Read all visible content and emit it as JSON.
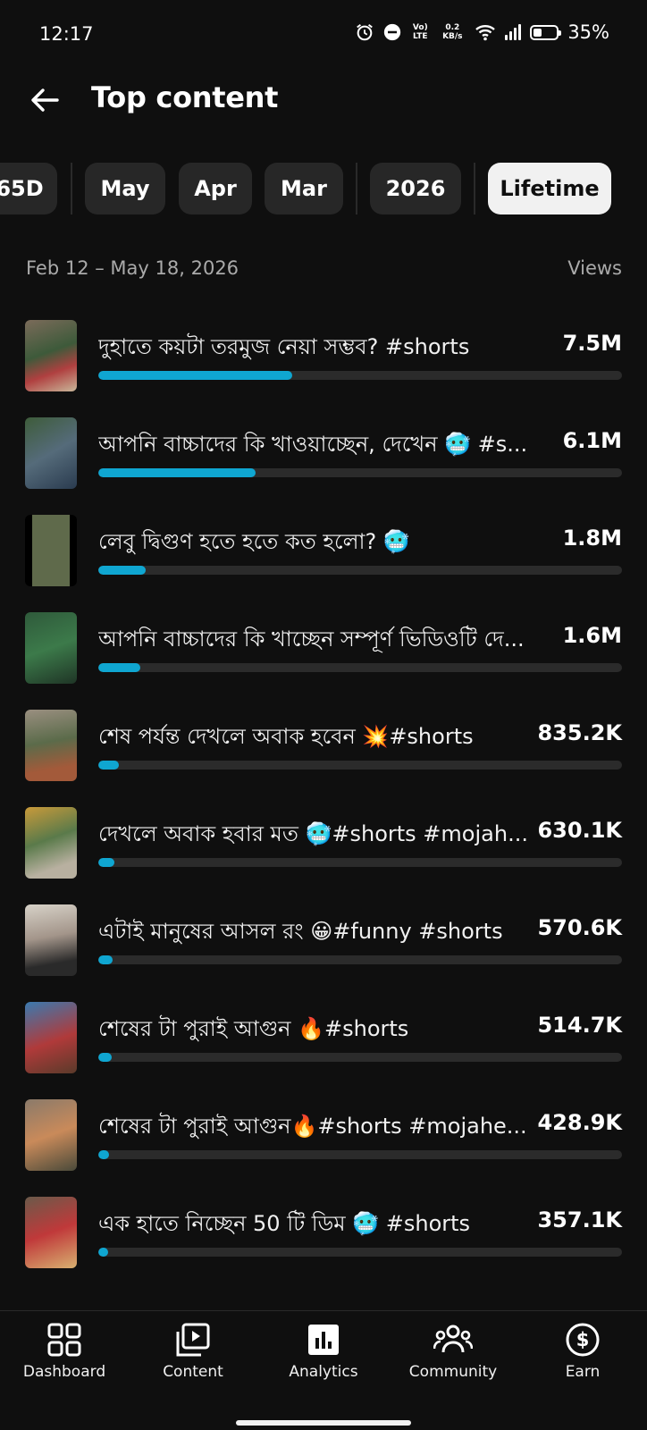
{
  "status_bar": {
    "time": "12:17",
    "volte": "Vo) LTE",
    "speed": "0.2 KB/s",
    "battery": "35%"
  },
  "header": {
    "title": "Top content",
    "back_icon": "arrow-left-icon"
  },
  "filters": [
    "65D",
    "May",
    "Apr",
    "Mar",
    "2026",
    "Lifetime"
  ],
  "active_filter": "Lifetime",
  "range": {
    "dates": "Feb 12 – May 18, 2026",
    "metric_label": "Views"
  },
  "accent_color": "#0fa6d1",
  "items": [
    {
      "title": "দুহাতে কয়টা তরমুজ নেয়া সম্ভব? #shorts",
      "views": "7.5M",
      "bar_fraction": 0.37
    },
    {
      "title": "আপনি বাচ্চাদের কি খাওয়াচ্ছেন, দেখেন 🥶 #s...",
      "views": "6.1M",
      "bar_fraction": 0.3
    },
    {
      "title": "লেবু দ্বিগুণ হতে হতে কত হলো? 🥶",
      "views": "1.8M",
      "bar_fraction": 0.09
    },
    {
      "title": "আপনি বাচ্চাদের কি খাচ্ছেন সম্পূর্ণ ভিডিওটি দে...",
      "views": "1.6M",
      "bar_fraction": 0.08
    },
    {
      "title": "শেষ পর্যন্ত দেখলে অবাক হবেন 💥#shorts",
      "views": "835.2K",
      "bar_fraction": 0.04
    },
    {
      "title": "দেখলে অবাক হবার মত 🥶#shorts #mojah...",
      "views": "630.1K",
      "bar_fraction": 0.03
    },
    {
      "title": "এটাই মানুষের আসল রং 😀#funny #shorts",
      "views": "570.6K",
      "bar_fraction": 0.027
    },
    {
      "title": "শেষের টা পুরাই আগুন 🔥#shorts",
      "views": "514.7K",
      "bar_fraction": 0.025
    },
    {
      "title": "শেষের টা পুরাই আগুন🔥#shorts #mojahe...",
      "views": "428.9K",
      "bar_fraction": 0.02
    },
    {
      "title": "এক হাতে নিচ্ছেন 50 টি ডিম 🥶 #shorts",
      "views": "357.1K",
      "bar_fraction": 0.018
    }
  ],
  "bottom_nav": [
    {
      "label": "Dashboard",
      "icon": "dashboard-grid-icon"
    },
    {
      "label": "Content",
      "icon": "content-play-icon"
    },
    {
      "label": "Analytics",
      "icon": "analytics-bars-icon"
    },
    {
      "label": "Community",
      "icon": "community-people-icon"
    },
    {
      "label": "Earn",
      "icon": "earn-dollar-icon"
    }
  ]
}
